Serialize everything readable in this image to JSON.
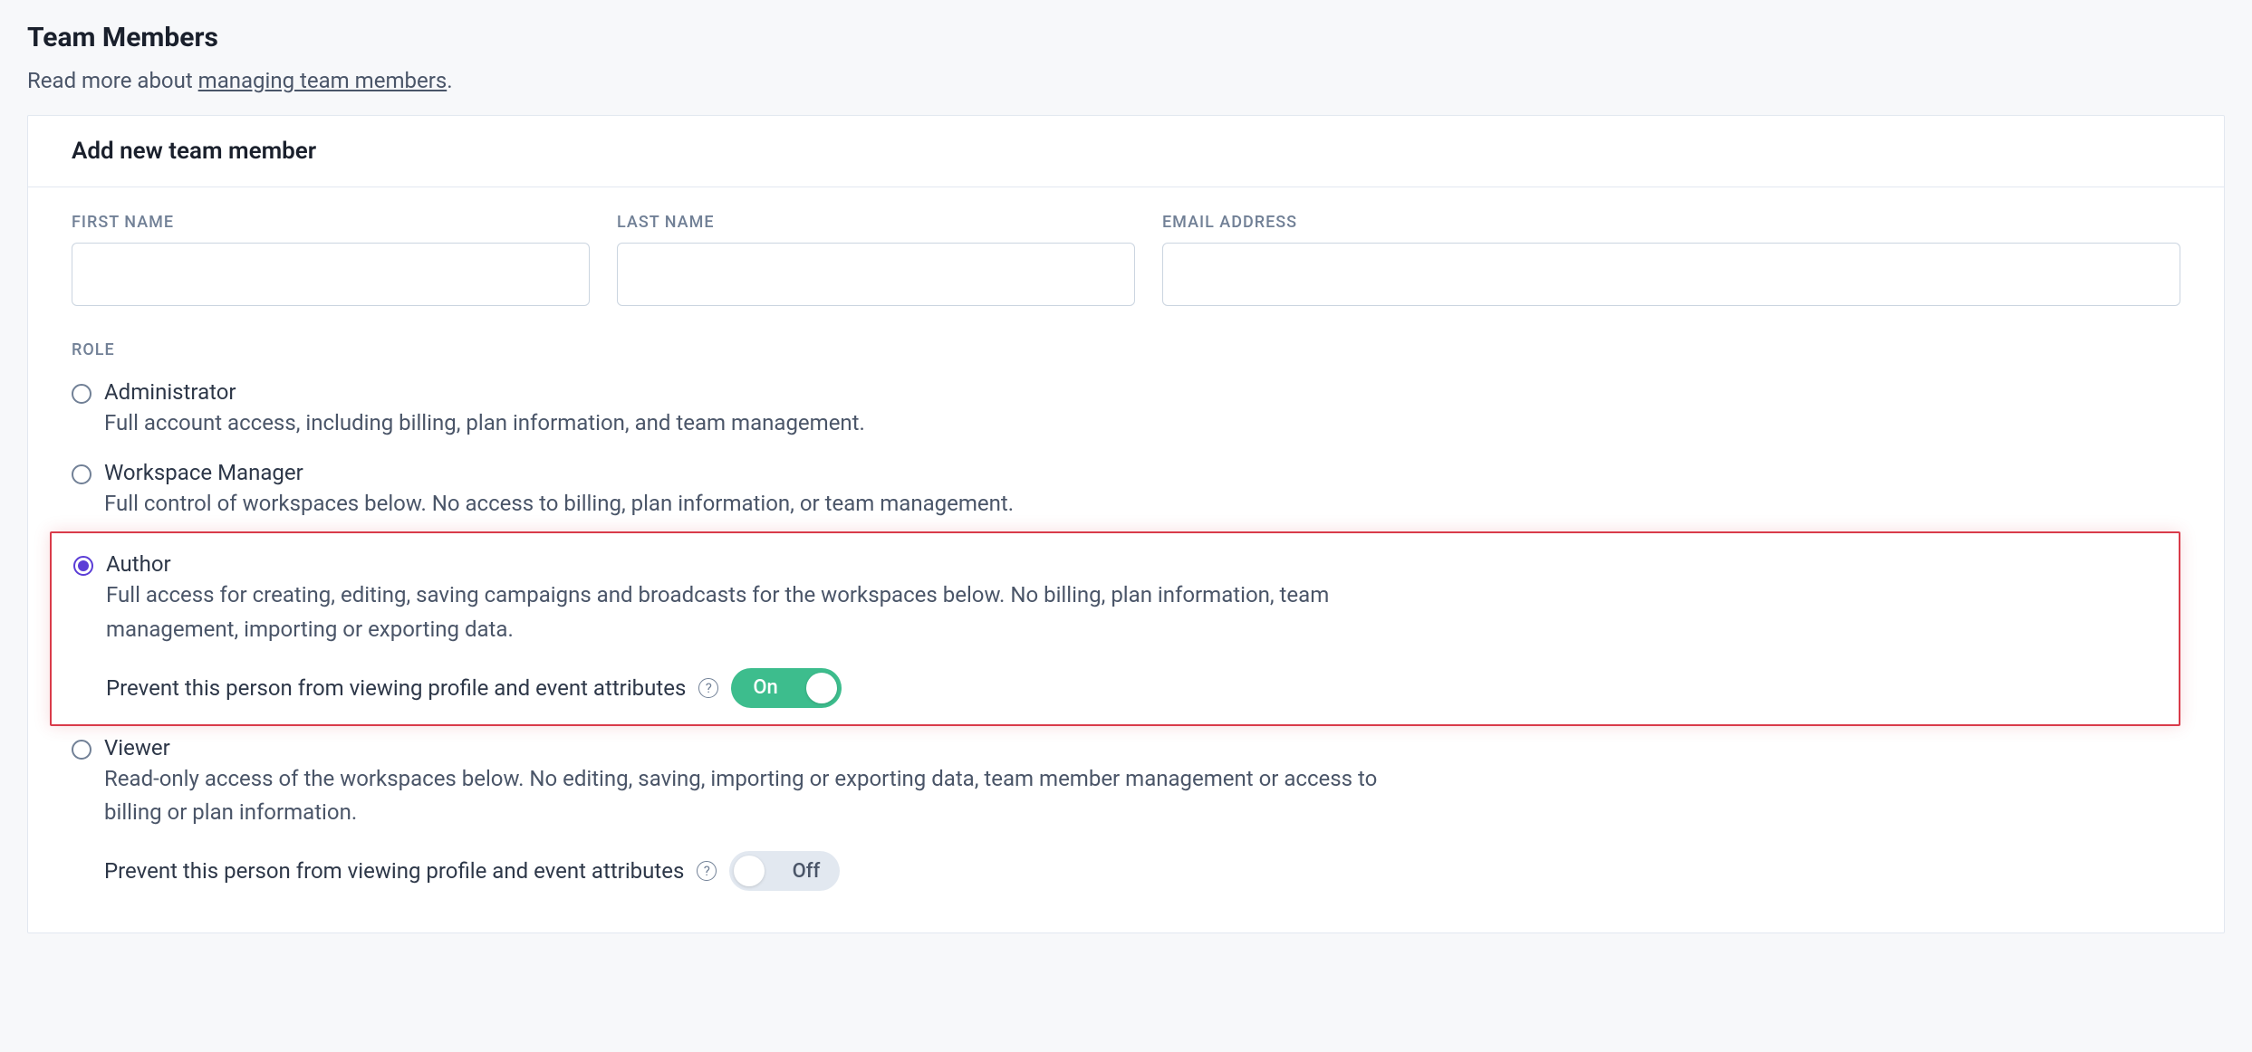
{
  "page": {
    "title": "Team Members",
    "subtitle_prefix": "Read more about ",
    "subtitle_link": "managing team members",
    "subtitle_suffix": "."
  },
  "card": {
    "header": "Add new team member"
  },
  "form": {
    "first_name_label": "FIRST NAME",
    "last_name_label": "LAST NAME",
    "email_label": "EMAIL ADDRESS",
    "first_name_value": "",
    "last_name_value": "",
    "email_value": ""
  },
  "role_section": {
    "label": "ROLE",
    "selected": "author",
    "options": [
      {
        "id": "administrator",
        "title": "Administrator",
        "desc": "Full account access, including billing, plan information, and team management.",
        "highlighted": false
      },
      {
        "id": "workspace_manager",
        "title": "Workspace Manager",
        "desc": "Full control of workspaces below. No access to billing, plan information, or team management.",
        "highlighted": false
      },
      {
        "id": "author",
        "title": "Author",
        "desc": "Full access for creating, editing, saving campaigns and broadcasts for the workspaces below. No billing, plan information, team management, importing or exporting data.",
        "highlighted": true,
        "prevent_toggle": {
          "label": "Prevent this person from viewing profile and event attributes",
          "state": "on",
          "text": "On"
        }
      },
      {
        "id": "viewer",
        "title": "Viewer",
        "desc": "Read-only access of the workspaces below. No editing, saving, importing or exporting data, team member management or access to billing or plan information.",
        "highlighted": false,
        "prevent_toggle": {
          "label": "Prevent this person from viewing profile and event attributes",
          "state": "off",
          "text": "Off"
        }
      }
    ]
  }
}
